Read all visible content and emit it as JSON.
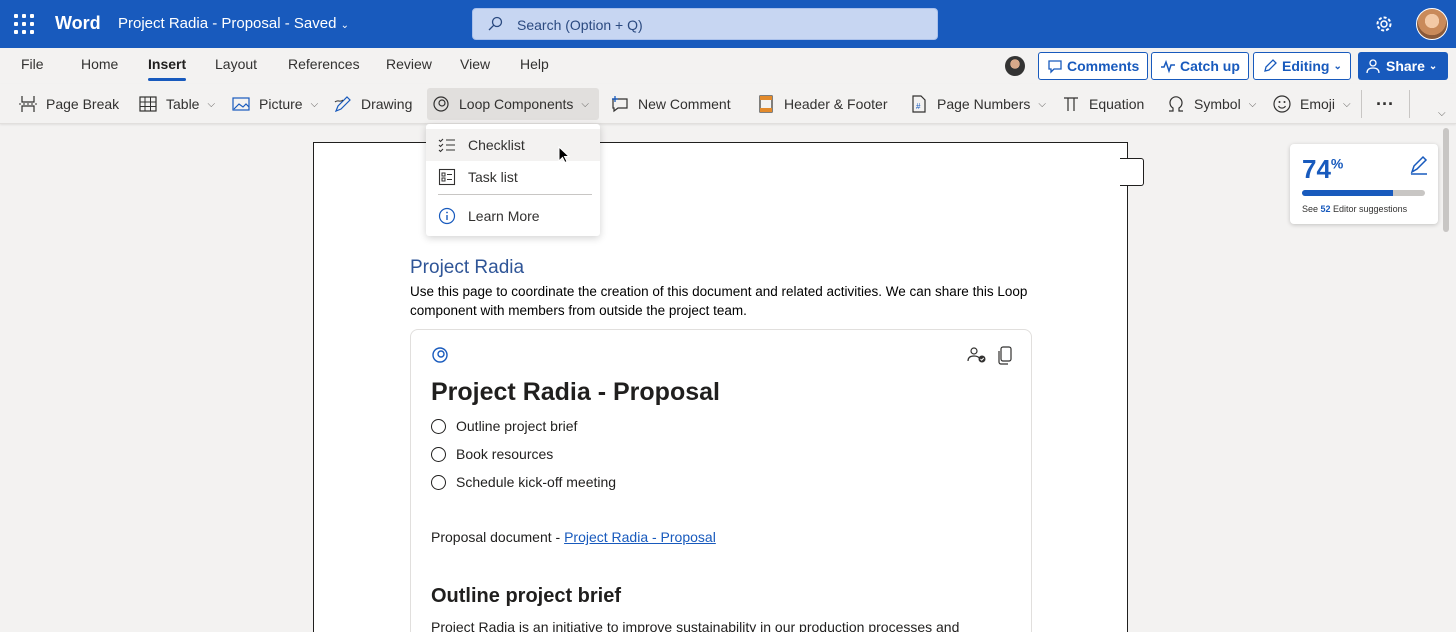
{
  "titlebar": {
    "app_name": "Word",
    "doc_title": "Project Radia - Proposal",
    "save_status": "Saved",
    "search_placeholder": "Search (Option + Q)"
  },
  "tabs": [
    "File",
    "Home",
    "Insert",
    "Layout",
    "References",
    "Review",
    "View",
    "Help"
  ],
  "active_tab": "Insert",
  "actions": {
    "comments": "Comments",
    "catch_up": "Catch up",
    "editing": "Editing",
    "share": "Share"
  },
  "ribbon": {
    "page_break": "Page Break",
    "table": "Table",
    "picture": "Picture",
    "drawing": "Drawing",
    "loop_components": "Loop Components",
    "new_comment": "New Comment",
    "header_footer": "Header & Footer",
    "page_numbers": "Page Numbers",
    "equation": "Equation",
    "symbol": "Symbol",
    "emoji": "Emoji",
    "more": "···"
  },
  "dropdown": {
    "items": [
      "Checklist",
      "Task list",
      "Learn More"
    ]
  },
  "document": {
    "heading": "Project Radia",
    "paragraph": "Use this page to coordinate the creation of this document and related activities. We can share this Loop component with members from outside the project team.",
    "loop": {
      "title": "Project Radia - Proposal",
      "tasks": [
        "Outline project brief",
        "Book resources",
        "Schedule kick-off meeting"
      ],
      "proposal_label": "Proposal document - ",
      "proposal_link": "Project Radia - Proposal",
      "section_heading": "Outline project brief",
      "section_text": "Project Radia is an initiative to improve sustainability in our production processes and"
    }
  },
  "editor_score": {
    "percent": "74",
    "percent_sign": "%",
    "fill_fraction": 0.74,
    "note_prefix": "See ",
    "count": "52",
    "note_suffix": " Editor suggestions"
  },
  "colors": {
    "brand": "#185abd",
    "heading": "#2f5597"
  }
}
